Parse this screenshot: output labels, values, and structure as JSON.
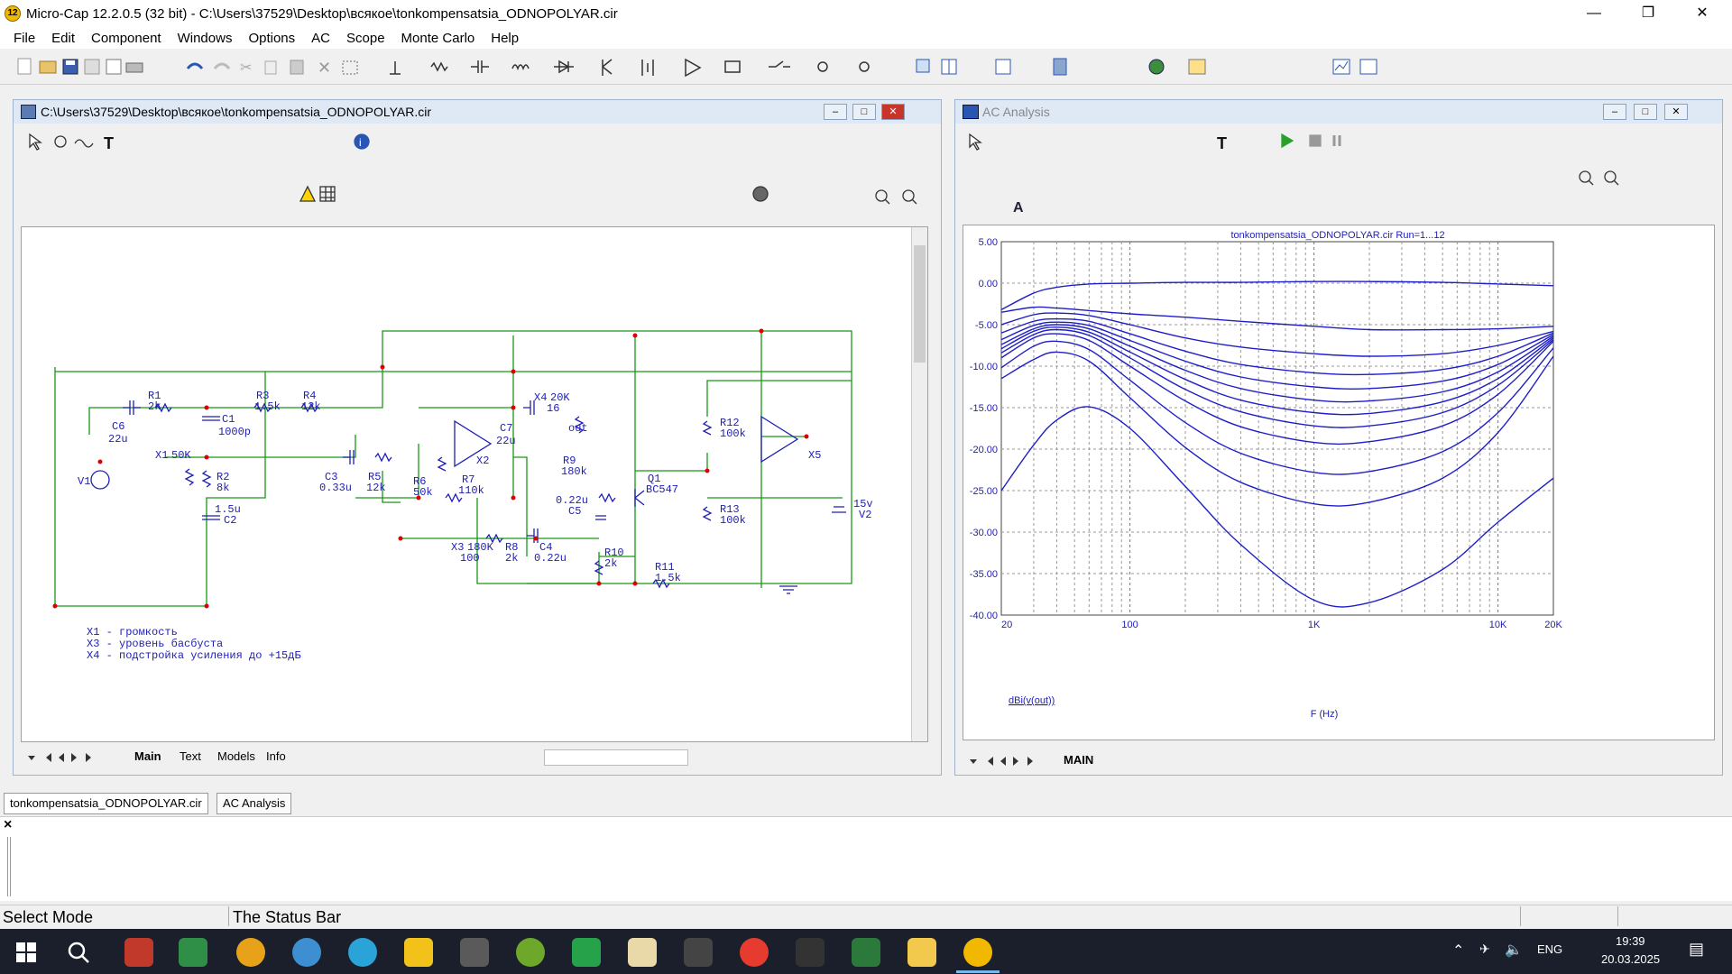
{
  "window": {
    "title": "Micro-Cap 12.2.0.5 (32 bit) - C:\\Users\\37529\\Desktop\\всякое\\tonkompensatsia_ODNOPOLYAR.cir",
    "app_badge": "12"
  },
  "menu": [
    "File",
    "Edit",
    "Component",
    "Windows",
    "Options",
    "AC",
    "Scope",
    "Monte Carlo",
    "Help"
  ],
  "schematic_window": {
    "title": "C:\\Users\\37529\\Desktop\\всякое\\tonkompensatsia_ODNOPOLYAR.cir",
    "tabs": [
      "Main",
      "Text",
      "Models",
      "Info"
    ],
    "labels": {
      "R1": "R1",
      "R1v": "2k",
      "C6": "C6",
      "C6v": "22u",
      "R3": "R3",
      "R3v": "1.5k",
      "R4": "R4",
      "R4v": "12k",
      "C1": "C1",
      "C1v": "1000p",
      "X1": "X1",
      "X1v": "50K",
      "R2": "R2",
      "R2v": "8k",
      "C2": "C2",
      "C2v": "1.5u",
      "V1": "V1",
      "C3": "C3",
      "C3v": "0.33u",
      "R5": "R5",
      "R5v": "12k",
      "R6": "R6",
      "R6v": "50k",
      "R7": "R7",
      "R7v": "110k",
      "X2": "X2",
      "C7": "C7",
      "C7v": "22u",
      "X4": "X4",
      "X4v": "20K",
      "X4n": "16",
      "out": "out",
      "R9": "R9",
      "R9v": "180k",
      "Q1": "Q1",
      "Q1v": "BC547",
      "C5": "C5",
      "C5v": "0.22u",
      "X3": "X3",
      "X3v": "180K",
      "X3n": "100",
      "R8": "R8",
      "R8v": "2k",
      "C4": "C4",
      "C4v": "0.22u",
      "R10": "R10",
      "R10v": "2k",
      "R11": "R11",
      "R11v": "1.5k",
      "R12": "R12",
      "R12v": "100k",
      "R13": "R13",
      "R13v": "100k",
      "X5": "X5",
      "V2": "V2",
      "V2v": "15v"
    },
    "notes": [
      "X1 - громкость",
      "X3 - уровень басбуста",
      "X4 - подстройка усиления до +15дБ"
    ]
  },
  "analysis_window": {
    "title": "AC Analysis",
    "plot_title": "tonkompensatsia_ODNOPOLYAR.cir Run=1...12",
    "y_expr": "dBi(v(out))",
    "x_label": "F (Hz)",
    "tab": "MAIN"
  },
  "chart_data": {
    "type": "line",
    "title": "tonkompensatsia_ODNOPOLYAR.cir Run=1...12",
    "xlabel": "F (Hz)",
    "ylabel": "dBi(v(out))",
    "xscale": "log",
    "xlim": [
      20,
      20000
    ],
    "ylim": [
      -40,
      5
    ],
    "xticks": [
      20,
      100,
      1000,
      10000,
      20000
    ],
    "xtick_labels": [
      "20",
      "100",
      "1K",
      "10K",
      "20K"
    ],
    "yticks": [
      5,
      0,
      -5,
      -10,
      -15,
      -20,
      -25,
      -30,
      -35,
      -40
    ],
    "ytick_labels": [
      "5.00",
      "0.00",
      "-5.00",
      "-10.00",
      "-15.00",
      "-20.00",
      "-25.00",
      "-30.00",
      "-35.00",
      "-40.00"
    ],
    "grid": true,
    "x": [
      20,
      30,
      40,
      60,
      100,
      200,
      400,
      1000,
      2000,
      5000,
      10000,
      20000
    ],
    "series": [
      {
        "values": [
          -3.2,
          -1.2,
          -0.5,
          -0.1,
          0.0,
          0.1,
          0.1,
          0.2,
          0.2,
          0.1,
          -0.1,
          -0.3
        ]
      },
      {
        "values": [
          -3.5,
          -2.9,
          -3.0,
          -3.3,
          -3.7,
          -4.1,
          -4.6,
          -5.2,
          -5.6,
          -5.6,
          -5.5,
          -5.2
        ]
      },
      {
        "values": [
          -5.0,
          -3.8,
          -3.6,
          -3.9,
          -5.0,
          -6.6,
          -7.7,
          -8.5,
          -8.8,
          -8.5,
          -7.5,
          -5.8
        ]
      },
      {
        "values": [
          -6.0,
          -4.6,
          -4.3,
          -4.6,
          -6.1,
          -8.2,
          -9.8,
          -10.8,
          -11.0,
          -10.4,
          -8.8,
          -6.0
        ]
      },
      {
        "values": [
          -6.8,
          -5.1,
          -4.7,
          -5.1,
          -6.9,
          -9.4,
          -11.3,
          -12.5,
          -12.7,
          -11.8,
          -9.8,
          -6.2
        ]
      },
      {
        "values": [
          -7.4,
          -5.5,
          -5.0,
          -5.5,
          -7.6,
          -10.5,
          -12.7,
          -14.1,
          -14.2,
          -13.1,
          -10.7,
          -6.4
        ]
      },
      {
        "values": [
          -7.9,
          -5.8,
          -5.3,
          -5.9,
          -8.3,
          -11.6,
          -14.1,
          -15.6,
          -15.7,
          -14.3,
          -11.5,
          -6.6
        ]
      },
      {
        "values": [
          -8.4,
          -6.2,
          -5.6,
          -6.3,
          -9.0,
          -12.8,
          -15.5,
          -17.2,
          -17.2,
          -15.6,
          -12.3,
          -6.8
        ]
      },
      {
        "values": [
          -9.0,
          -6.6,
          -6.1,
          -6.9,
          -10.0,
          -14.2,
          -17.3,
          -19.2,
          -19.1,
          -17.2,
          -13.4,
          -7.0
        ]
      },
      {
        "values": [
          -10.2,
          -7.6,
          -7.0,
          -8.0,
          -11.7,
          -16.8,
          -20.5,
          -22.8,
          -22.7,
          -20.3,
          -15.6,
          -7.8
        ]
      },
      {
        "values": [
          -11.5,
          -9.2,
          -8.3,
          -9.4,
          -13.8,
          -19.8,
          -24.0,
          -26.6,
          -26.4,
          -23.5,
          -18.0,
          -8.8
        ]
      },
      {
        "values": [
          -25.0,
          -19.5,
          -16.5,
          -14.9,
          -17.5,
          -24.5,
          -31.5,
          -38.2,
          -38.5,
          -34.5,
          -28.8,
          -23.5
        ]
      }
    ]
  },
  "doc_tabs": [
    "tonkompensatsia_ODNOPOLYAR.cir",
    "AC Analysis"
  ],
  "statusbar": {
    "mode": "Select Mode",
    "message": "The Status Bar"
  },
  "tray": {
    "lang": "ENG",
    "time": "19:39",
    "date": "20.03.2025"
  }
}
